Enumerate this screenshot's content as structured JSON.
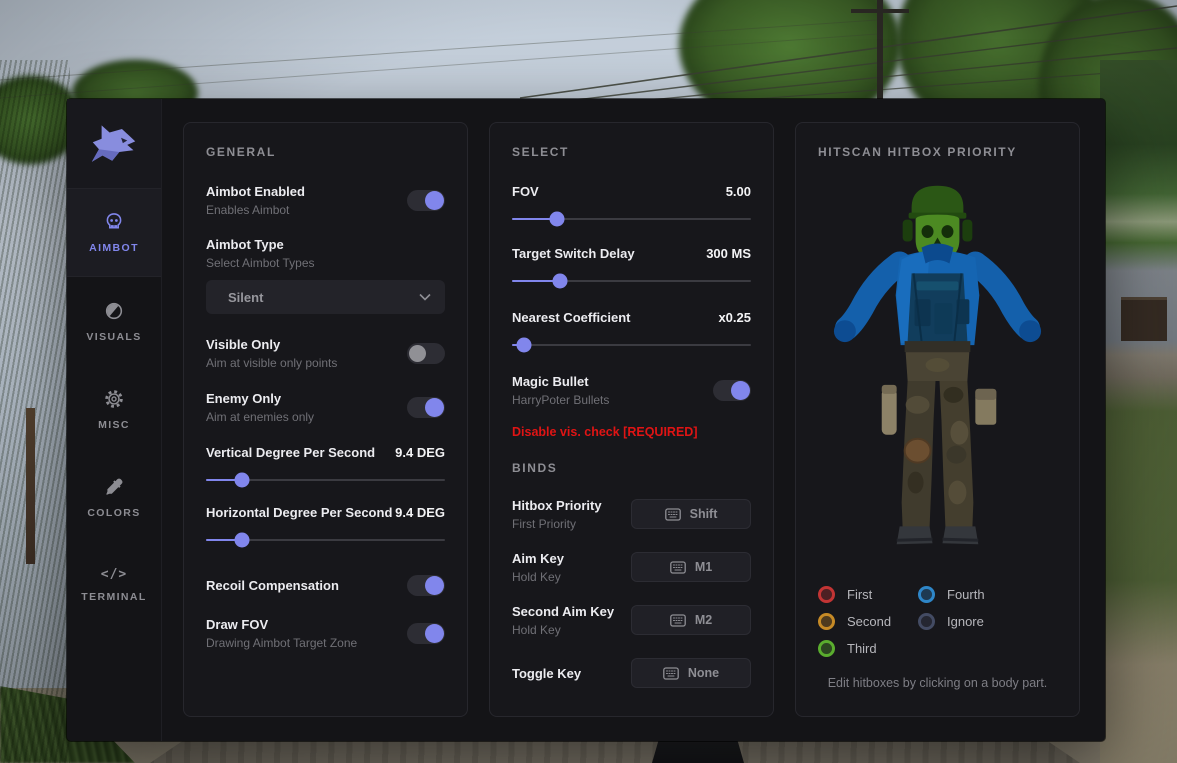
{
  "colors": {
    "accent": "#8186ec",
    "warning": "#e01414"
  },
  "sidebar": {
    "logo_icon": "wolf-logo-icon",
    "items": [
      {
        "label": "AIMBOT",
        "icon": "skull-icon",
        "active": true
      },
      {
        "label": "VISUALS",
        "icon": "contrast-icon",
        "active": false
      },
      {
        "label": "MISC",
        "icon": "gear-icon",
        "active": false
      },
      {
        "label": "COLORS",
        "icon": "eyedropper-icon",
        "active": false
      },
      {
        "label": "TERMINAL",
        "icon": "code-icon",
        "active": false
      }
    ]
  },
  "general": {
    "title": "GENERAL",
    "aimbot_enabled": {
      "label": "Aimbot Enabled",
      "sublabel": "Enables Aimbot",
      "value": true
    },
    "aimbot_type": {
      "label": "Aimbot Type",
      "sublabel": "Select Aimbot Types",
      "value": "Silent"
    },
    "visible_only": {
      "label": "Visible Only",
      "sublabel": "Aim at visible only points",
      "value": false
    },
    "enemy_only": {
      "label": "Enemy Only",
      "sublabel": "Aim at enemies only",
      "value": true
    },
    "vertical_dps": {
      "label": "Vertical Degree Per Second",
      "value": "9.4 DEG",
      "percent": 15
    },
    "horizontal_dps": {
      "label": "Horizontal Degree Per Second",
      "value": "9.4 DEG",
      "percent": 15
    },
    "recoil_comp": {
      "label": "Recoil Compensation",
      "value": true
    },
    "draw_fov": {
      "label": "Draw FOV",
      "sublabel": "Drawing Aimbot Target Zone",
      "value": true
    }
  },
  "select": {
    "title": "SELECT",
    "fov": {
      "label": "FOV",
      "value": "5.00",
      "percent": 19
    },
    "target_switch_delay": {
      "label": "Target Switch Delay",
      "value": "300 MS",
      "percent": 20
    },
    "nearest_coefficient": {
      "label": "Nearest Coefficient",
      "value": "x0.25",
      "percent": 5
    },
    "magic_bullet": {
      "label": "Magic Bullet",
      "sublabel": "HarryPoter Bullets",
      "value": true
    },
    "warning": "Disable vis. check [REQUIRED]"
  },
  "binds": {
    "title": "BINDS",
    "items": [
      {
        "label": "Hitbox Priority",
        "sublabel": "First Priority",
        "key": "Shift"
      },
      {
        "label": "Aim Key",
        "sublabel": "Hold Key",
        "key": "M1"
      },
      {
        "label": "Second Aim Key",
        "sublabel": "Hold Key",
        "key": "M2"
      },
      {
        "label": "Toggle Key",
        "sublabel": "",
        "key": "None"
      }
    ]
  },
  "hitbox": {
    "title": "HITSCAN HITBOX PRIORITY",
    "legend": [
      {
        "label": "First",
        "color": "#c23434"
      },
      {
        "label": "Second",
        "color": "#c68a26"
      },
      {
        "label": "Third",
        "color": "#5aad2e"
      },
      {
        "label": "Fourth",
        "color": "#2e86c8"
      },
      {
        "label": "Ignore",
        "color": "#434b63"
      }
    ],
    "hint": "Edit hitboxes by clicking on a body part."
  }
}
